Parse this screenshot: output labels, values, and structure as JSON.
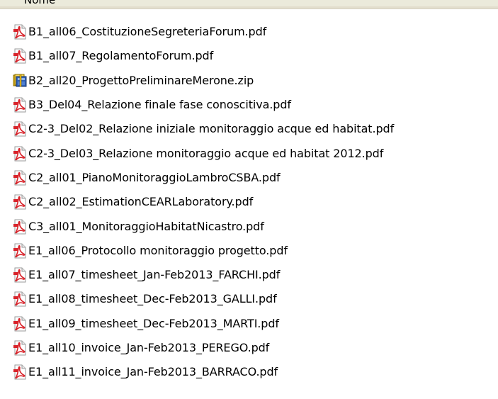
{
  "column_header": {
    "label": "Nome"
  },
  "files": [
    {
      "name": "B1_all06_CostituzioneSegreteriaForum.pdf",
      "icon": "pdf-icon"
    },
    {
      "name": "B1_all07_RegolamentoForum.pdf",
      "icon": "pdf-icon"
    },
    {
      "name": "B2_all20_ProgettoPreliminareMerone.zip",
      "icon": "zip-icon"
    },
    {
      "name": "B3_Del04_Relazione finale fase conoscitiva.pdf",
      "icon": "pdf-icon"
    },
    {
      "name": "C2-3_Del02_Relazione iniziale monitoraggio acque ed habitat.pdf",
      "icon": "pdf-icon"
    },
    {
      "name": "C2-3_Del03_Relazione monitoraggio acque ed habitat 2012.pdf",
      "icon": "pdf-icon"
    },
    {
      "name": "C2_all01_PianoMonitoraggioLambroCSBA.pdf",
      "icon": "pdf-icon"
    },
    {
      "name": "C2_all02_EstimationCEARLaboratory.pdf",
      "icon": "pdf-icon"
    },
    {
      "name": "C3_all01_MonitoraggioHabitatNicastro.pdf",
      "icon": "pdf-icon"
    },
    {
      "name": "E1_all06_Protocollo monitoraggio progetto.pdf",
      "icon": "pdf-icon"
    },
    {
      "name": "E1_all07_timesheet_Jan-Feb2013_FARCHI.pdf",
      "icon": "pdf-icon"
    },
    {
      "name": "E1_all08_timesheet_Dec-Feb2013_GALLI.pdf",
      "icon": "pdf-icon"
    },
    {
      "name": "E1_all09_timesheet_Dec-Feb2013_MARTI.pdf",
      "icon": "pdf-icon"
    },
    {
      "name": "E1_all10_invoice_Jan-Feb2013_PEREGO.pdf",
      "icon": "pdf-icon"
    },
    {
      "name": "E1_all11_invoice_Jan-Feb2013_BARRACO.pdf",
      "icon": "pdf-icon"
    }
  ],
  "colors": {
    "pdf_red": "#d8232a",
    "pdf_page": "#ffffff",
    "zip_blue": "#2f5fb3",
    "zip_yellow": "#f2c21b",
    "header_bg": "#ebeadb"
  }
}
